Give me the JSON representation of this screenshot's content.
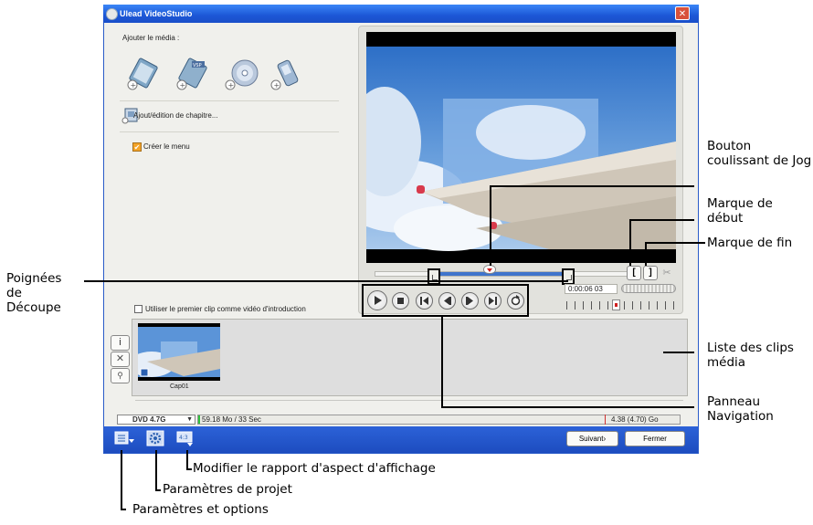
{
  "window": {
    "title": "Ulead VideoStudio",
    "close": "✕"
  },
  "left_panel": {
    "add_media_label": "Ajouter le média :",
    "media_icons": [
      "video-file-icon",
      "vsp-file-icon",
      "disc-icon",
      "device-icon"
    ],
    "chapter_label": "Ajout/édition de chapitre...",
    "create_menu_label": "Créer le menu",
    "first_clip_label": "Utiliser le premier clip comme vidéo d'introduction"
  },
  "preview": {
    "timecode": "0:00:06 03"
  },
  "side_tools": {
    "info": "i",
    "delete": "✕",
    "zoom": "⚲"
  },
  "clip": {
    "name": "Cap01"
  },
  "status": {
    "disc_type": "DVD 4.7G",
    "used": "59.18 Mo / 33 Sec",
    "capacity": "4.38 (4.70) Go"
  },
  "buttons": {
    "next": "Suivant›",
    "close": "Fermer"
  },
  "annotations": {
    "jog": "Bouton coulissant de Jog",
    "mark_in": "Marque de début",
    "mark_out": "Marque de fin",
    "trim": "Poignées de Découpe",
    "list": "Liste des clips média",
    "nav": "Panneau Navigation",
    "aspect": "Modifier le rapport d'aspect d'affichage",
    "project": "Paramètres de projet",
    "settings": "Paramètres et options"
  },
  "colors": {
    "titlebar": "#2a63dc",
    "window": "#f0f0ec",
    "sky": "#3b7fd0",
    "accent": "#d8513b"
  }
}
